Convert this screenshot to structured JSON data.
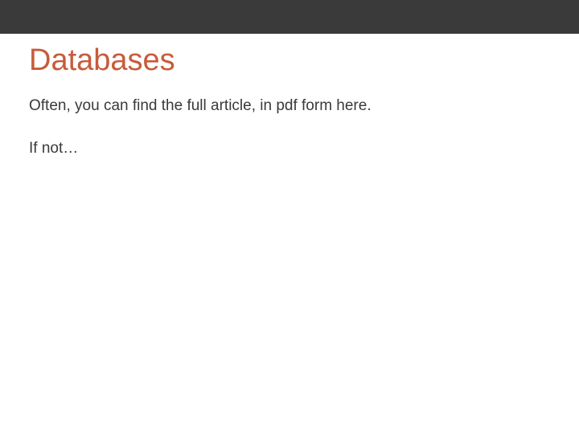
{
  "slide": {
    "title": "Databases",
    "paragraph1": "Often, you can find the full article, in pdf form here.",
    "paragraph2": "If not…"
  },
  "colors": {
    "topBar": "#3a3a3a",
    "title": "#c75b3b",
    "text": "#3a3a3a",
    "background": "#ffffff"
  }
}
